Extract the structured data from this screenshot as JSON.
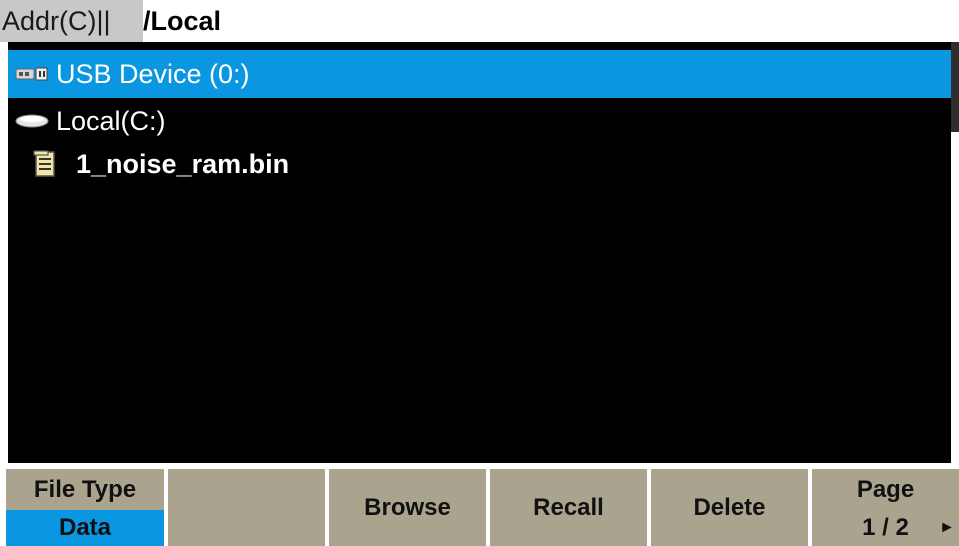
{
  "address": {
    "label": "Addr(C)||",
    "path": "/Local"
  },
  "browser": {
    "items": [
      {
        "label": "USB Device (0:)",
        "icon": "usb-drive-icon",
        "selected": true
      },
      {
        "label": "Local(C:)",
        "icon": "local-disk-icon",
        "selected": false
      },
      {
        "label": "1_noise_ram.bin",
        "icon": "file-icon",
        "selected": false
      }
    ]
  },
  "softkeys": {
    "file_type": {
      "label": "File Type",
      "value": "Data"
    },
    "blank": "",
    "browse": "Browse",
    "recall": "Recall",
    "delete": "Delete",
    "page": {
      "label": "Page",
      "value": "1 / 2",
      "arrow": "►"
    }
  },
  "colors": {
    "selection": "#0a96e0",
    "softkey_bg": "#aaa48f",
    "browser_bg": "#000000"
  }
}
